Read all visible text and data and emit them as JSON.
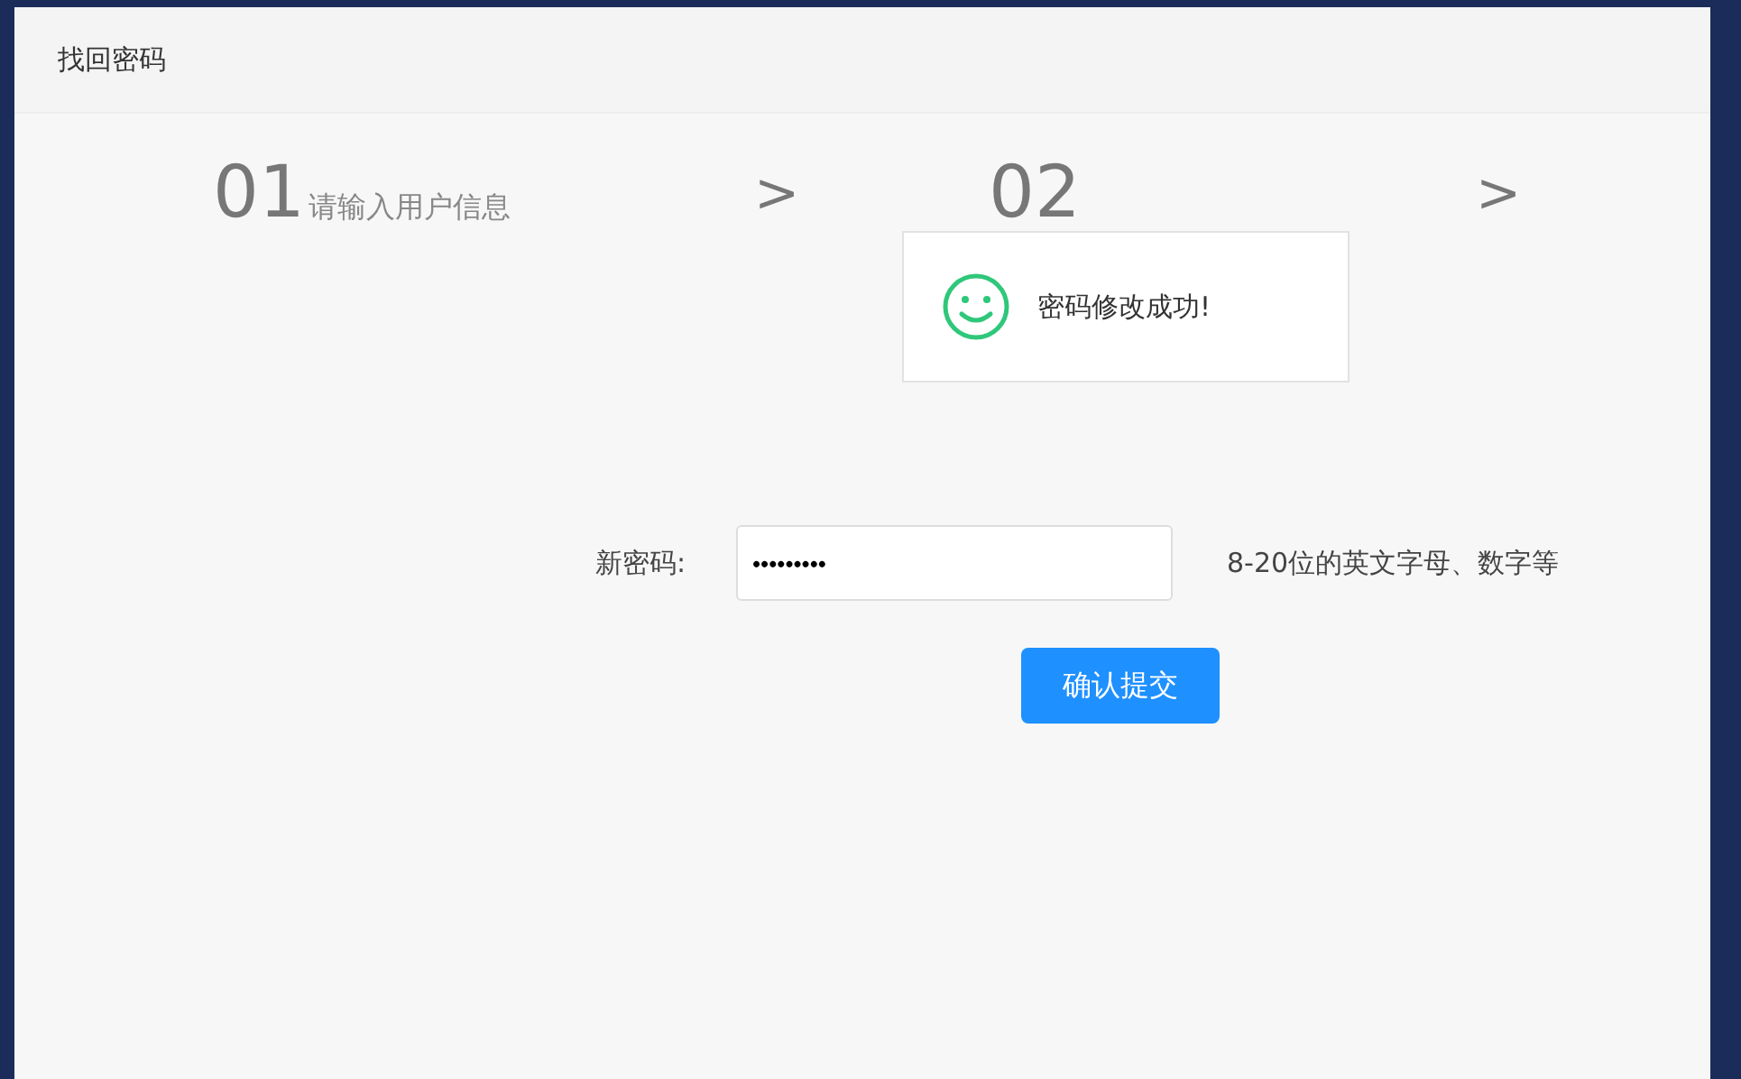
{
  "window": {
    "title": "找回密码"
  },
  "steps": [
    {
      "number": "01",
      "label": "请输入用户信息"
    },
    {
      "number": "02"
    }
  ],
  "step_separators": [
    ">",
    ">"
  ],
  "form": {
    "label": "新密码:",
    "value": "•••••••••",
    "hint": "8-20位的英文字母、数字等",
    "submit": "确认提交"
  },
  "toast": {
    "kind": "success",
    "message": "密码修改成功!"
  }
}
